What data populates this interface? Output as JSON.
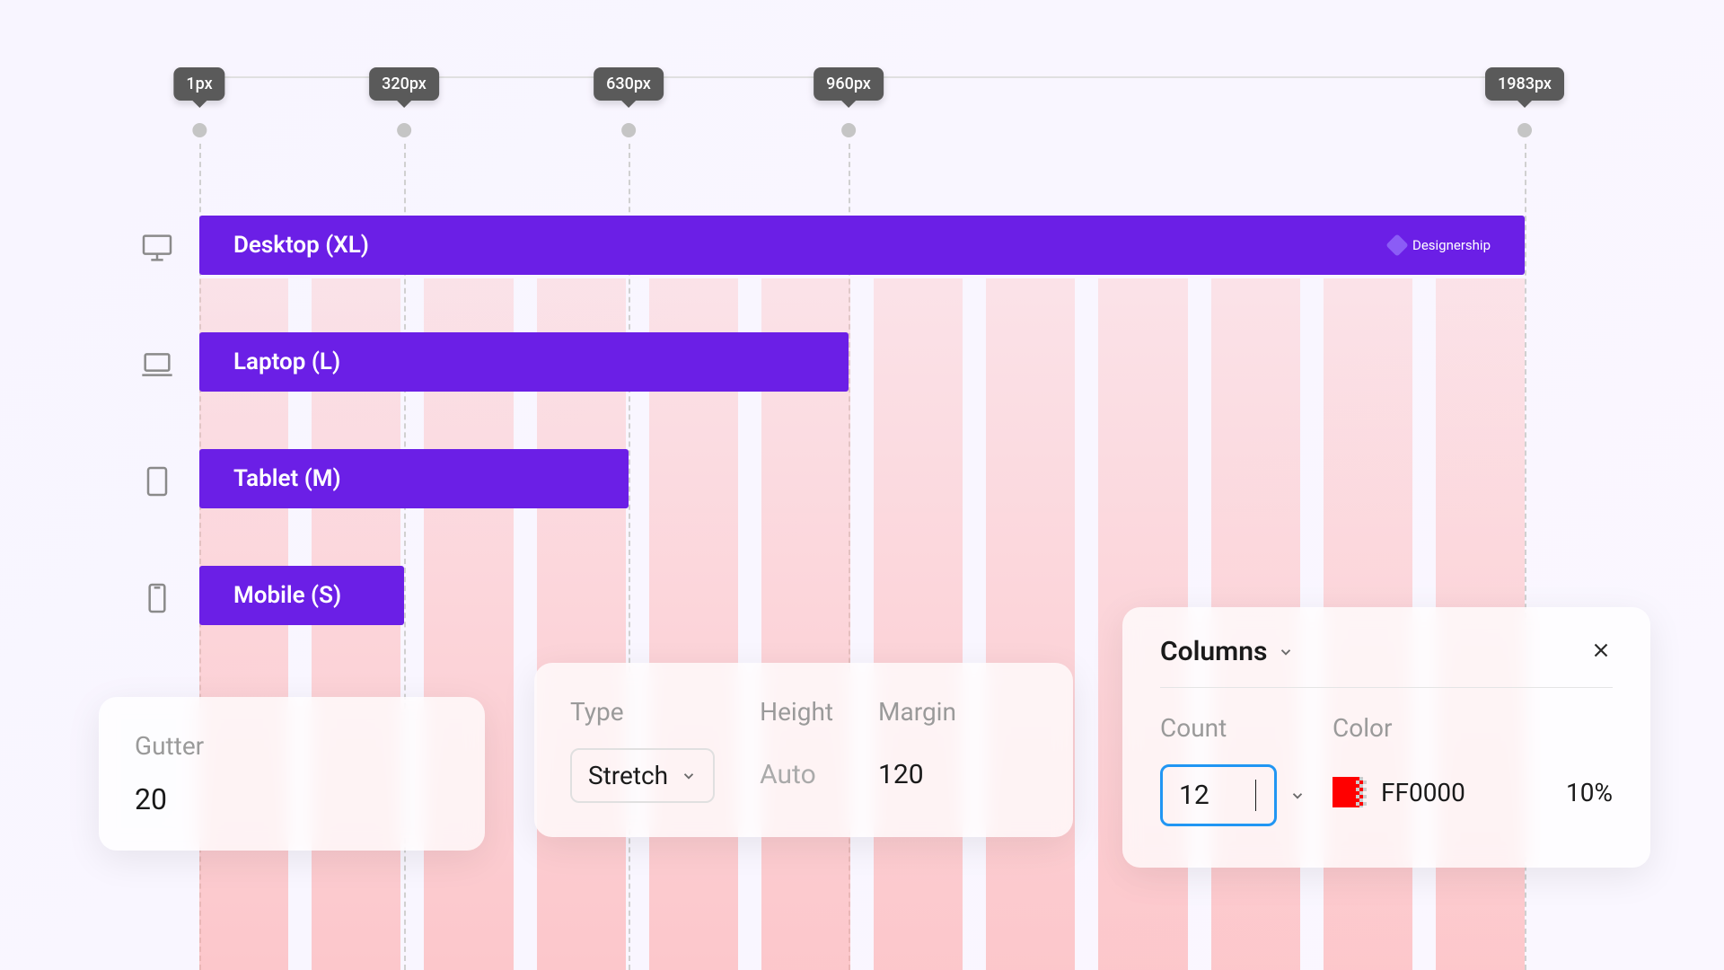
{
  "ruler": {
    "markers": [
      {
        "label": "1px",
        "pos": 222
      },
      {
        "label": "320px",
        "pos": 450
      },
      {
        "label": "630px",
        "pos": 700
      },
      {
        "label": "960px",
        "pos": 945
      },
      {
        "label": "1983px",
        "pos": 1698
      }
    ]
  },
  "breakpoints": {
    "desktop": "Desktop (XL)",
    "laptop": "Laptop (L)",
    "tablet": "Tablet (M)",
    "mobile": "Mobile (S)"
  },
  "brand": "Designership",
  "panels": {
    "gutter_label": "Gutter",
    "gutter_value": "20",
    "type_label": "Type",
    "type_value": "Stretch",
    "height_label": "Height",
    "height_value": "Auto",
    "margin_label": "Margin",
    "margin_value": "120"
  },
  "columns": {
    "title": "Columns",
    "count_label": "Count",
    "count_value": "12",
    "color_label": "Color",
    "color_hex": "FF0000",
    "color_opacity": "10%"
  }
}
